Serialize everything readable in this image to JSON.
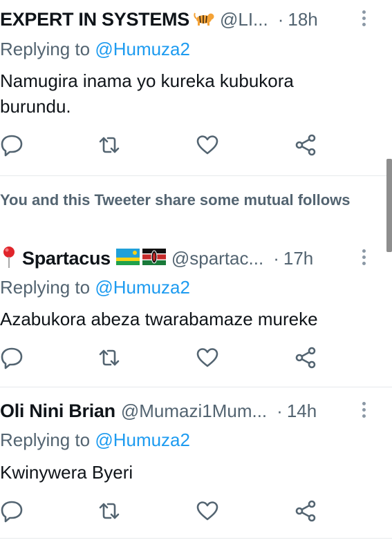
{
  "tweets": [
    {
      "name": "EXPERT IN SYSTEMS",
      "name_emoji": "tiger-emoji",
      "handle": "@LI...",
      "separator": "·",
      "time": "18h",
      "replying_prefix": "Replying to",
      "replying_to": "@Humuza2",
      "text": "Namugira inama yo kureka kubukora burundu."
    },
    {
      "mutual_notice": "You and this Tweeter share some mutual follows",
      "prefix_emoji": "round-pushpin-emoji",
      "name": "Spartacus",
      "flags": [
        "rwanda-flag",
        "kenya-flag"
      ],
      "handle": "@spartac...",
      "separator": "·",
      "time": "17h",
      "replying_prefix": "Replying to",
      "replying_to": "@Humuza2",
      "text": "Azabukora abeza twarabamaze mureke"
    },
    {
      "name": "Oli Nini Brian",
      "handle": "@Mumazi1Mum...",
      "separator": "·",
      "time": "14h",
      "replying_prefix": "Replying to",
      "replying_to": "@Humuza2",
      "text": "Kwinywera Byeri"
    }
  ],
  "action_icons": [
    "reply-icon",
    "retweet-icon",
    "like-icon",
    "share-icon"
  ],
  "colors": {
    "link": "#1d9bf0",
    "secondary": "#536471",
    "text": "#0f1419",
    "divider": "#e6e9ec"
  }
}
